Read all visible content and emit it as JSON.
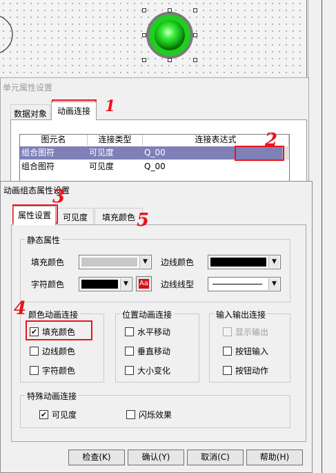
{
  "unit_dialog": {
    "title": "单元属性设置",
    "tabs": [
      "数据对象",
      "动画连接"
    ],
    "columns": [
      "图元名",
      "连接类型",
      "连接表达式"
    ],
    "rows": [
      {
        "name": "组合图符",
        "type": "可见度",
        "expr": "Q_00"
      },
      {
        "name": "组合图符",
        "type": "可见度",
        "expr": "Q_00"
      }
    ]
  },
  "anim_dialog": {
    "title": "动画组态属性设置",
    "tabs": [
      "属性设置",
      "可见度",
      "填充颜色"
    ],
    "static_group": {
      "legend": "静态属性",
      "fill_color_label": "填充颜色",
      "line_color_label": "边线颜色",
      "char_color_label": "字符颜色",
      "line_style_label": "边线线型",
      "font_button_text": "Aa"
    },
    "color_anim_group": {
      "legend": "颜色动画连接",
      "items": [
        {
          "label": "填充颜色",
          "checked": true
        },
        {
          "label": "边线颜色",
          "checked": false
        },
        {
          "label": "字符颜色",
          "checked": false
        }
      ]
    },
    "position_anim_group": {
      "legend": "位置动画连接",
      "items": [
        {
          "label": "水平移动",
          "checked": false
        },
        {
          "label": "垂直移动",
          "checked": false
        },
        {
          "label": "大小变化",
          "checked": false
        }
      ]
    },
    "io_group": {
      "legend": "输入输出连接",
      "items": [
        {
          "label": "显示输出",
          "checked": false,
          "disabled": true
        },
        {
          "label": "按钮输入",
          "checked": false
        },
        {
          "label": "按钮动作",
          "checked": false
        }
      ]
    },
    "special_group": {
      "legend": "特殊动画连接",
      "visibility_label": "可见度",
      "visibility_checked": true,
      "blink_label": "闪烁效果",
      "blink_checked": false
    },
    "buttons": {
      "check": "检查(K)",
      "ok": "确认(Y)",
      "cancel": "取消(C)",
      "help": "帮助(H)"
    }
  },
  "colors": {
    "fill_color": "#c8c8c8",
    "line_color": "#000000",
    "char_color": "#000000",
    "selection": "#7e80b7",
    "annotation_red": "#e8141e",
    "lamp_green": "#1ecf1e"
  },
  "annotations": [
    "1",
    "2",
    "3",
    "4",
    "5"
  ],
  "icons": {
    "combo_arrow": "▼",
    "check_mark": "✔"
  }
}
